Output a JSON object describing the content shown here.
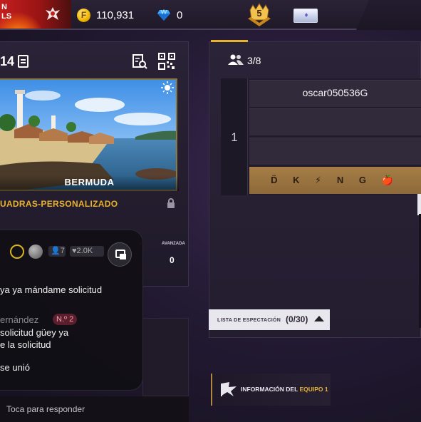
{
  "topbar": {
    "player_name_fragment": "N\nLS",
    "coins": "110,931",
    "coin_symbol": "F",
    "diamonds": "0",
    "rank_level": "5"
  },
  "room": {
    "id_fragment": "14",
    "map_name": "BERMUDA",
    "mode_label": "UADRAS-PERSONALIZADO",
    "advanced_label": "AVANZADA",
    "advanced_value": "0",
    "partial_label": "A"
  },
  "chat": {
    "members_count": "7",
    "likes_count": "2.0K",
    "messages": [
      {
        "text": "ya ya mándame solicitud"
      },
      {
        "sender": "ernández",
        "badge": "N.º 2"
      },
      {
        "text": "solicitud güey ya"
      },
      {
        "text": "e la solicitud"
      },
      {
        "text": "se unió"
      }
    ],
    "reply_placeholder": "Toca para responder"
  },
  "team": {
    "players_count": "3/8",
    "team_number": "1",
    "slots": [
      {
        "name": "oscar050536G"
      },
      {
        "name": ""
      },
      {
        "name": ""
      },
      {
        "name": "D̈ K ⚡ N G 🍎"
      }
    ],
    "spectator_label": "LISTA DE ESPECTACIÓN",
    "spectator_count": "(0/30)",
    "info_label_prefix": "INFORMACIÓN DEL ",
    "info_label_highlight": "EQUIPO 1"
  },
  "colors": {
    "accent_gold": "#e9b22e",
    "banner_red": "#c41e1e",
    "slot_gold": "#a57d46"
  }
}
